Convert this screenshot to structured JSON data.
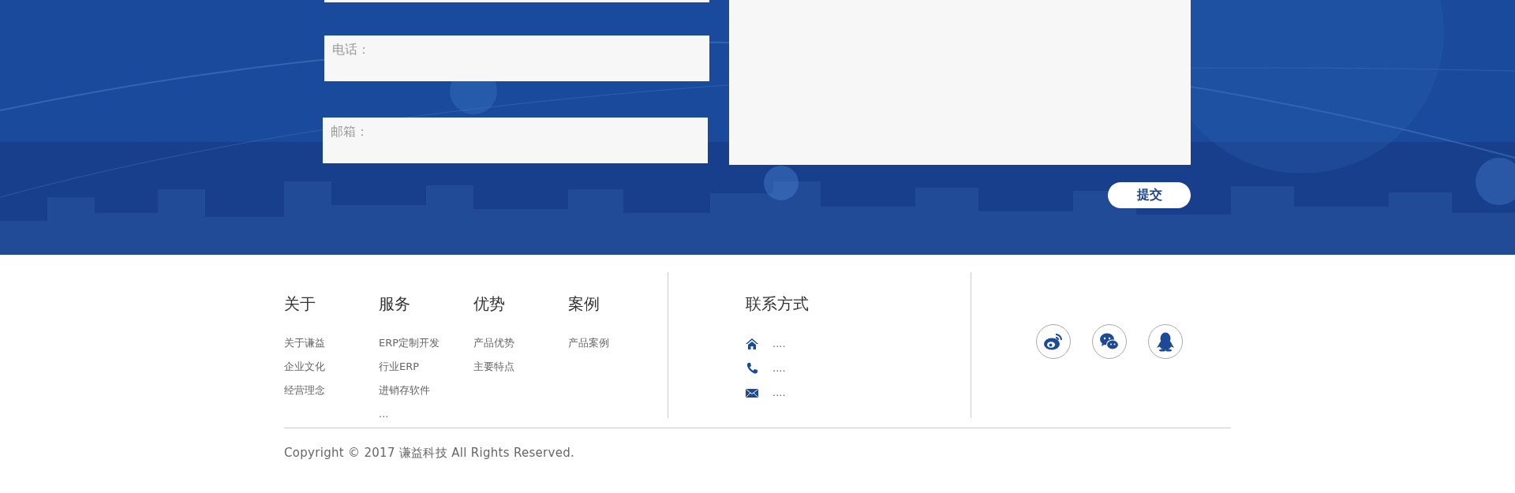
{
  "form": {
    "fields": [
      {
        "placeholder": "电话："
      },
      {
        "placeholder": "邮箱："
      }
    ],
    "submit": "提交"
  },
  "footer": {
    "columns": [
      {
        "title": "关于",
        "items": [
          "关于谦益",
          "企业文化",
          "经营理念"
        ]
      },
      {
        "title": "服务",
        "items": [
          "ERP定制开发",
          "行业ERP",
          "进销存软件",
          "..."
        ]
      },
      {
        "title": "优势",
        "items": [
          "产品优势",
          "主要特点"
        ]
      },
      {
        "title": "案例",
        "items": [
          "产品案例"
        ]
      }
    ],
    "contact": {
      "title": "联系方式",
      "items": [
        {
          "kind": "address",
          "text": "...."
        },
        {
          "kind": "phone",
          "text": "...."
        },
        {
          "kind": "email",
          "text": "...."
        }
      ]
    },
    "social": [
      {
        "kind": "weibo"
      },
      {
        "kind": "wechat"
      },
      {
        "kind": "qq"
      }
    ],
    "copyright": "Copyright © 2017 谦益科技 All Rights Reserved."
  }
}
